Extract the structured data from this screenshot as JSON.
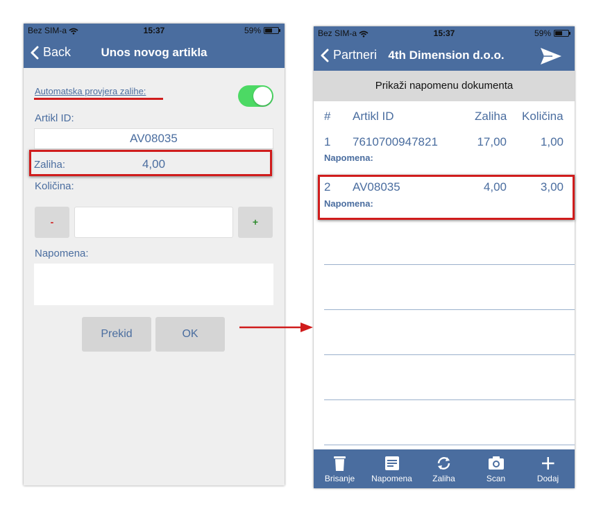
{
  "status": {
    "carrier": "Bez SIM-a",
    "time": "15:37",
    "battery": "59%"
  },
  "left": {
    "back_label": "Back",
    "title": "Unos novog artikla",
    "auto_check_label": "Automatska provjera zalihe:",
    "auto_check_on": true,
    "artikl_label": "Artikl ID:",
    "artikl_value": "AV08035",
    "zaliha_label": "Zaliha:",
    "zaliha_value": "4,00",
    "kolicina_label": "Količina:",
    "minus_label": "-",
    "plus_label": "+",
    "quantity_value": "",
    "napomena_label": "Napomena:",
    "napomena_value": "",
    "cancel_label": "Prekid",
    "ok_label": "OK"
  },
  "right": {
    "back_label": "Partneri",
    "title": "4th Dimension d.o.o.",
    "doc_note_label": "Prikaži napomenu dokumenta",
    "columns": [
      "#",
      "Artikl ID",
      "Zaliha",
      "Količina"
    ],
    "rows": [
      {
        "num": "1",
        "artikl": "7610700947821",
        "zaliha": "17,00",
        "kolicina": "1,00",
        "note_label": "Napomena:"
      },
      {
        "num": "2",
        "artikl": "AV08035",
        "zaliha": "4,00",
        "kolicina": "3,00",
        "note_label": "Napomena:"
      }
    ],
    "tabs": [
      {
        "label": "Brisanje",
        "icon": "trash-icon"
      },
      {
        "label": "Napomena",
        "icon": "note-icon"
      },
      {
        "label": "Zaliha",
        "icon": "refresh-icon"
      },
      {
        "label": "Scan",
        "icon": "camera-icon"
      },
      {
        "label": "Dodaj",
        "icon": "plus-icon"
      }
    ]
  },
  "colors": {
    "brand": "#4a6d9f",
    "highlight": "#d01c1c",
    "toggle_on": "#4cd964"
  }
}
